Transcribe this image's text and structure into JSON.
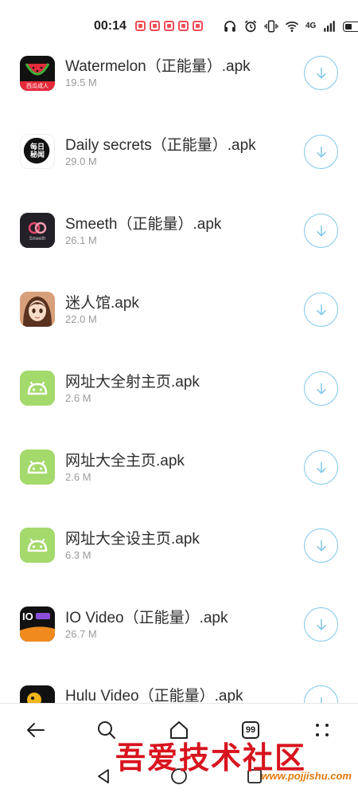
{
  "status_bar": {
    "time": "00:14",
    "notification_count": 5,
    "network": "4G",
    "icons": [
      "headphones-icon",
      "alarm-icon",
      "vibrate-icon",
      "wifi-icon",
      "signal-icon",
      "battery-icon"
    ]
  },
  "apk_list": [
    {
      "name": "Watermelon（正能量）.apk",
      "size": "19.5 M",
      "icon": "watermelon-app-icon"
    },
    {
      "name": "Daily secrets（正能量）.apk",
      "size": "29.0 M",
      "icon": "daily-secrets-app-icon"
    },
    {
      "name": "Smeeth（正能量）.apk",
      "size": "26.1 M",
      "icon": "smeeth-app-icon"
    },
    {
      "name": "迷人馆.apk",
      "size": "22.0 M",
      "icon": "anime-girl-app-icon"
    },
    {
      "name": "网址大全射主页.apk",
      "size": "2.6 M",
      "icon": "android-icon"
    },
    {
      "name": "网址大全主页.apk",
      "size": "2.6 M",
      "icon": "android-icon"
    },
    {
      "name": "网址大全设主页.apk",
      "size": "6.3 M",
      "icon": "android-icon"
    },
    {
      "name": "IO Video（正能量）.apk",
      "size": "26.7 M",
      "icon": "io-video-app-icon"
    },
    {
      "name": "Hulu Video（正能量）.apk",
      "size": "",
      "icon": "hulu-video-app-icon"
    }
  ],
  "icon_labels": {
    "watermelon": "西瓜成人",
    "daily_secrets": "每日\n秘闻",
    "smeeth": "Smeeth",
    "io_video_badge": "IO"
  },
  "toolbar": {
    "tab_count": "99",
    "buttons": [
      "back-arrow-icon",
      "search-icon",
      "home-icon",
      "tabs-icon",
      "more-icon"
    ]
  },
  "watermark": {
    "title": "吾爱技术社区",
    "url": "www.pojjishu.com"
  },
  "colors": {
    "accent": "#7fc8ec",
    "android_green": "#a4d96c",
    "watermark_red": "#d8141e",
    "watermark_orange": "#e07a12"
  }
}
